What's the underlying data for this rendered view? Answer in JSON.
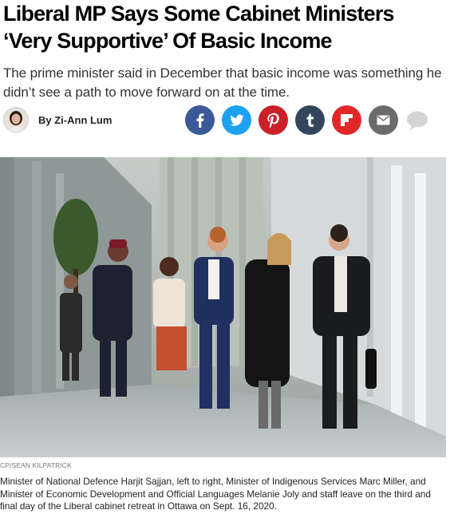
{
  "article": {
    "headline": "Liberal MP Says Some Cabinet Ministers ‘Very Supportive’ Of Basic Income",
    "subhead": "The prime minister said in December that basic income was something he didn’t see a path to move forward on at the time.",
    "author": "By Zi-Ann Lum"
  },
  "share": {
    "buttons": [
      {
        "network": "facebook",
        "icon": "facebook-icon",
        "color": "#3b5998"
      },
      {
        "network": "twitter",
        "icon": "twitter-icon",
        "color": "#1da1f2"
      },
      {
        "network": "pinterest",
        "icon": "pinterest-icon",
        "color": "#cb2027"
      },
      {
        "network": "tumblr",
        "icon": "tumblr-icon",
        "color": "#35465c"
      },
      {
        "network": "flipboard",
        "icon": "flipboard-icon",
        "color": "#e12828"
      },
      {
        "network": "email",
        "icon": "envelope-icon",
        "color": "#6b6b6b"
      },
      {
        "network": "comments",
        "icon": "comment-bubble-icon",
        "color": "#d4d4d4"
      }
    ]
  },
  "photo": {
    "credit": "CP/SEAN KILPATRICK",
    "caption": "Minister of National Defence Harjit Sajjan, left to right, Minister of Indigenous Services Marc Miller, and Minister of Economic Development and Official Languages Melanie Joly and staff leave on the third and final day of the Liberal cabinet retreat in Ottawa on Sept. 16, 2020."
  }
}
